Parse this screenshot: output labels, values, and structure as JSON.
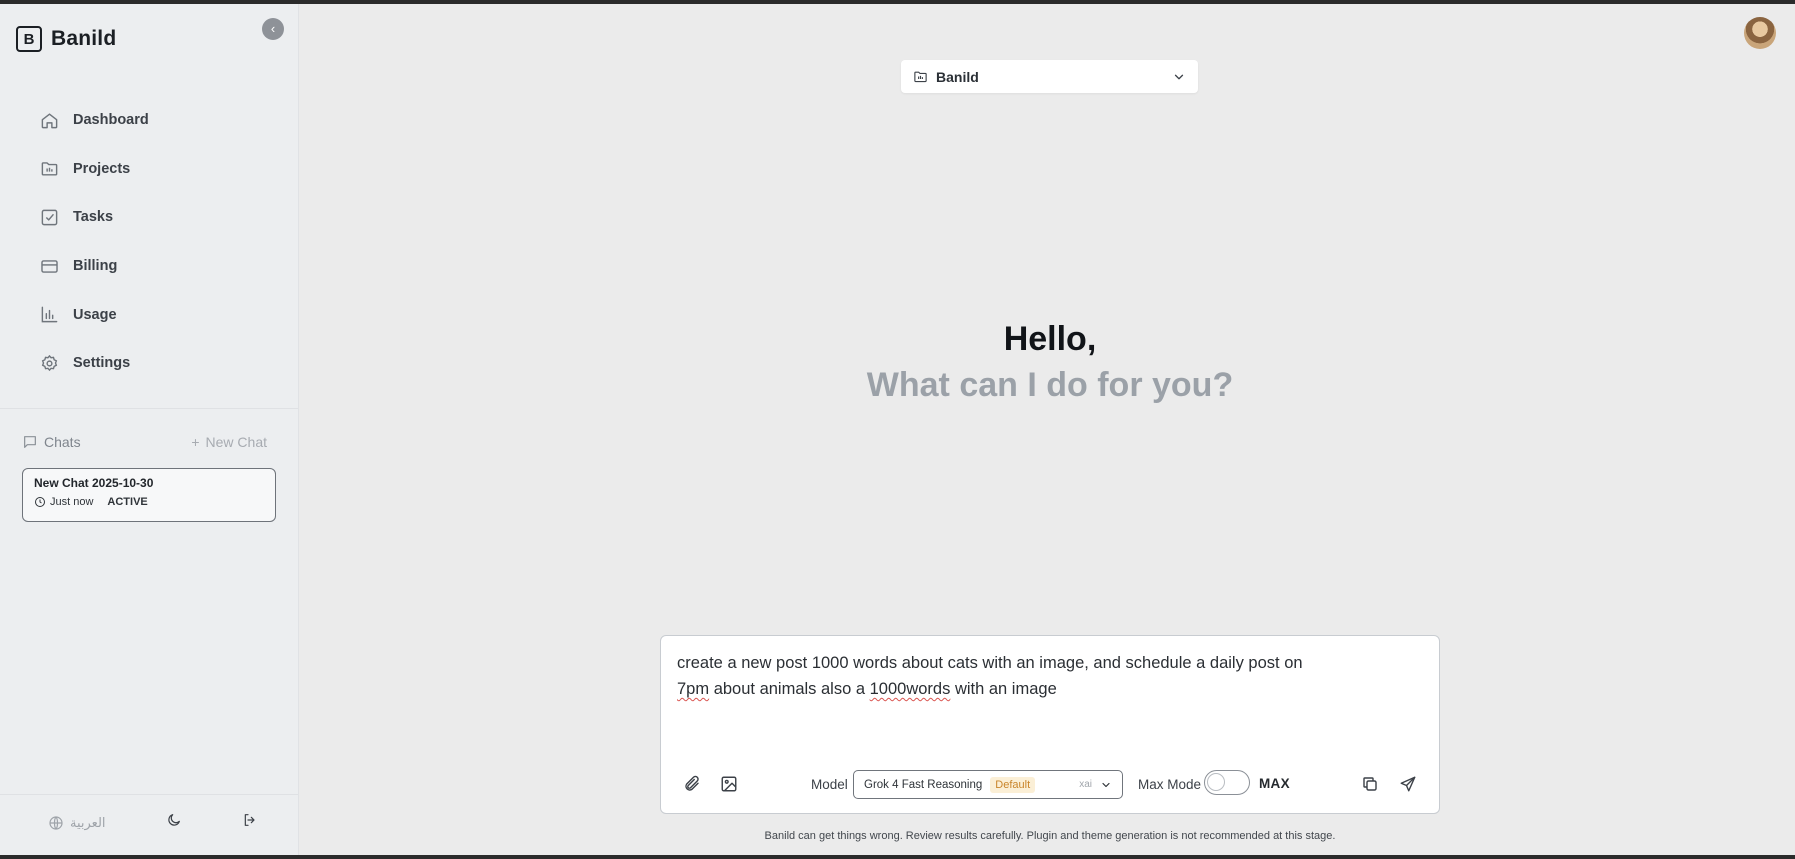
{
  "app": {
    "name": "Banild",
    "logo_letter": "B"
  },
  "sidebar": {
    "collapse_icon": "chevron-left-icon",
    "nav": [
      {
        "label": "Dashboard",
        "icon": "home-icon"
      },
      {
        "label": "Projects",
        "icon": "folder-icon"
      },
      {
        "label": "Tasks",
        "icon": "checkbox-icon"
      },
      {
        "label": "Billing",
        "icon": "credit-card-icon"
      },
      {
        "label": "Usage",
        "icon": "bar-chart-icon"
      },
      {
        "label": "Settings",
        "icon": "gear-icon"
      }
    ],
    "chats": {
      "label": "Chats",
      "new_chat_label": "New Chat",
      "items": [
        {
          "title": "New Chat 2025-10-30",
          "time": "Just now",
          "status": "ACTIVE"
        }
      ]
    },
    "footer": {
      "language_label": "العربية"
    }
  },
  "main": {
    "project_selector": {
      "value": "Banild"
    },
    "greeting": {
      "hello": "Hello,",
      "prompt": "What can I do for you?"
    },
    "composer": {
      "line1_pre": "create a new post 1000 words about cats with an image, and schedule a daily post on",
      "line2_word1": "7pm",
      "line2_mid": " about animals also a ",
      "line2_word2": "1000words",
      "line2_end": " with an image",
      "model_label": "Model",
      "model_name": "Grok 4 Fast Reasoning",
      "model_badge": "Default",
      "model_provider": "xai",
      "max_mode_label": "Max Mode",
      "max_mode_on": false,
      "max_label": "MAX"
    },
    "disclaimer": "Banild can get things wrong. Review results carefully. Plugin and theme generation is not recommended at this stage."
  },
  "colors": {
    "sidebar_bg": "#eceef0",
    "main_bg": "#ebebeb",
    "badge_text": "#c9852b",
    "badge_bg": "#fbefd6"
  }
}
